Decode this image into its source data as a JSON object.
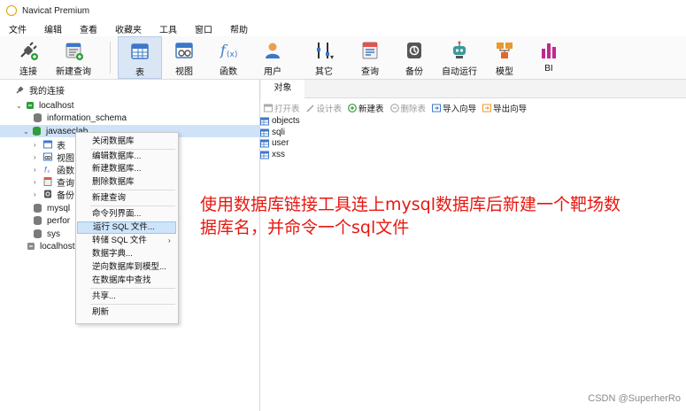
{
  "window": {
    "title": "Navicat Premium",
    "logo_icon": "navicat-logo-icon"
  },
  "menubar": {
    "items": [
      "文件",
      "编辑",
      "查看",
      "收藏夹",
      "工具",
      "窗口",
      "帮助"
    ]
  },
  "toolbar": {
    "buttons": [
      {
        "label": "连接",
        "icon": "connect-plug-icon"
      },
      {
        "label": "新建查询",
        "icon": "new-query-icon"
      },
      {
        "label": "表",
        "icon": "table-icon",
        "active": true
      },
      {
        "label": "视图",
        "icon": "view-icon"
      },
      {
        "label": "函数",
        "icon": "function-icon"
      },
      {
        "label": "用户",
        "icon": "user-icon"
      },
      {
        "label": "其它",
        "icon": "tools-icon"
      },
      {
        "label": "查询",
        "icon": "query-icon"
      },
      {
        "label": "备份",
        "icon": "backup-icon"
      },
      {
        "label": "自动运行",
        "icon": "robot-icon"
      },
      {
        "label": "模型",
        "icon": "model-icon"
      },
      {
        "label": "BI",
        "icon": "bi-icon"
      }
    ]
  },
  "tree": {
    "root": "我的连接",
    "connection": "localhost",
    "databases": [
      "information_schema",
      "javaseclab"
    ],
    "children": [
      "表",
      "视图",
      "函数",
      "查询",
      "备份"
    ],
    "other_dbs": [
      "mysql",
      "perfor",
      "sys"
    ],
    "second_connection": "localhost"
  },
  "context_menu": {
    "groups": [
      [
        "关闭数据库"
      ],
      [
        "编辑数据库...",
        "新建数据库...",
        "删除数据库"
      ],
      [
        "新建查询"
      ],
      [
        "命令列界面...",
        "运行 SQL 文件...",
        "转储 SQL 文件",
        "数据字典...",
        "逆向数据库到模型...",
        "在数据库中查找"
      ],
      [
        "共享..."
      ],
      [
        "刷新"
      ]
    ],
    "highlighted": "运行 SQL 文件..."
  },
  "right_pane": {
    "tab": "对象",
    "toolbar": [
      {
        "label": "打开表",
        "icon": "open-table-icon",
        "enabled": false
      },
      {
        "label": "设计表",
        "icon": "design-table-icon",
        "enabled": false
      },
      {
        "label": "新建表",
        "icon": "new-table-icon",
        "enabled": true
      },
      {
        "label": "删除表",
        "icon": "delete-table-icon",
        "enabled": false
      },
      {
        "label": "导入向导",
        "icon": "import-wizard-icon",
        "enabled": true
      },
      {
        "label": "导出向导",
        "icon": "export-wizard-icon",
        "enabled": true
      }
    ],
    "tables": [
      "objects",
      "sqli",
      "user",
      "xss"
    ]
  },
  "annotation": {
    "line1": "使用数据库链接工具连上mysql数据库后新建一个靶场数",
    "line2": "据库名，并命令一个sql文件",
    "color": "#e8170f"
  },
  "watermark": "CSDN @SuperherRo"
}
